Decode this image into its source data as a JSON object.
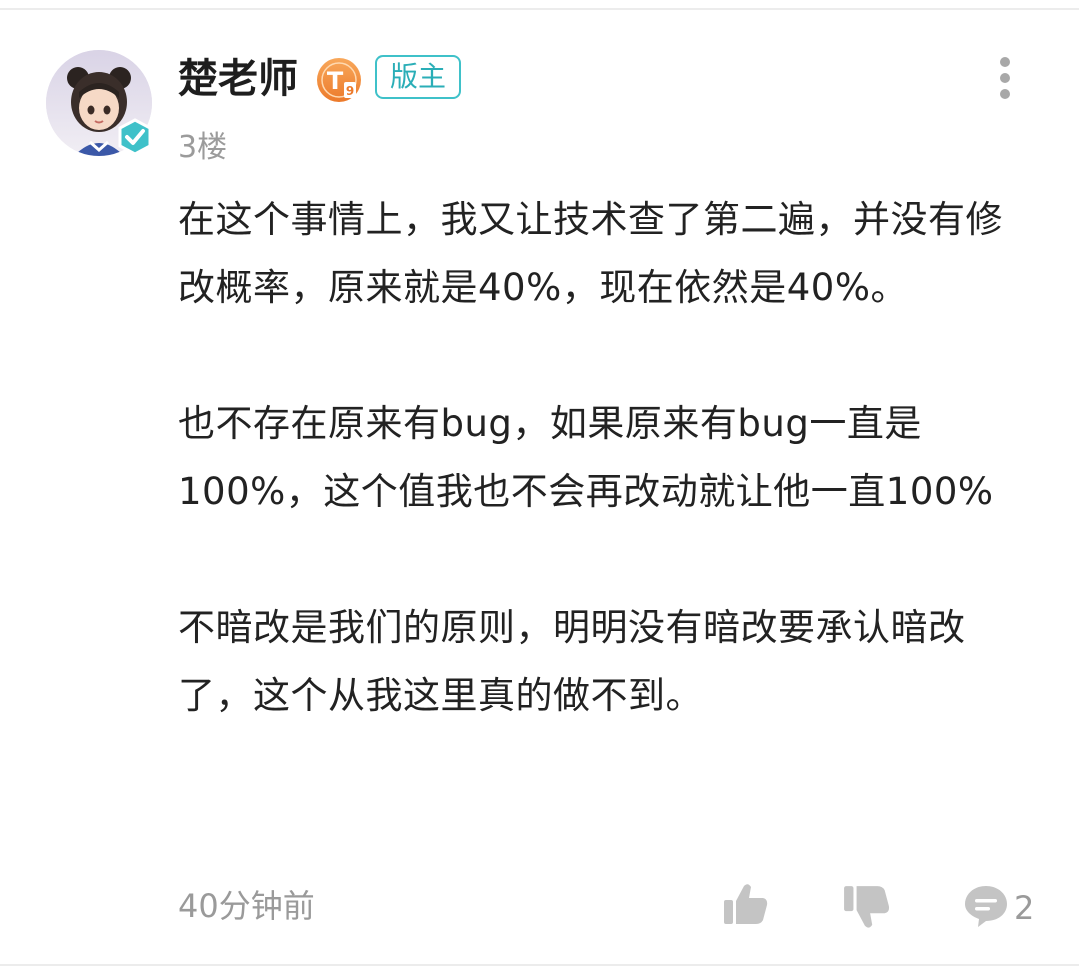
{
  "post": {
    "author": {
      "name": "楚老师",
      "level_badge": "T",
      "level_number": "9",
      "role_badge": "版主",
      "avatar_icon": "avatar-girl-icon",
      "verified_icon": "verified-check-icon"
    },
    "floor": "3楼",
    "paragraphs": [
      "在这个事情上，我又让技术查了第二遍，并没有修改概率，原来就是40%，现在依然是40%。",
      "也不存在原来有bug，如果原来有bug一直是100%，这个值我也不会再改动就让他一直100%",
      "不暗改是我们的原则，明明没有暗改要承认暗改了，这个从我这里真的做不到。"
    ],
    "time": "40分钟前",
    "reply_count": "2",
    "icons": {
      "more": "more-vertical-icon",
      "like": "thumbs-up-icon",
      "dislike": "thumbs-down-icon",
      "reply": "comment-bubble-icon"
    },
    "colors": {
      "accent": "#3fc1c9",
      "level_badge": "#f08a3a",
      "text": "#222222",
      "muted": "#9a9a9a"
    }
  }
}
